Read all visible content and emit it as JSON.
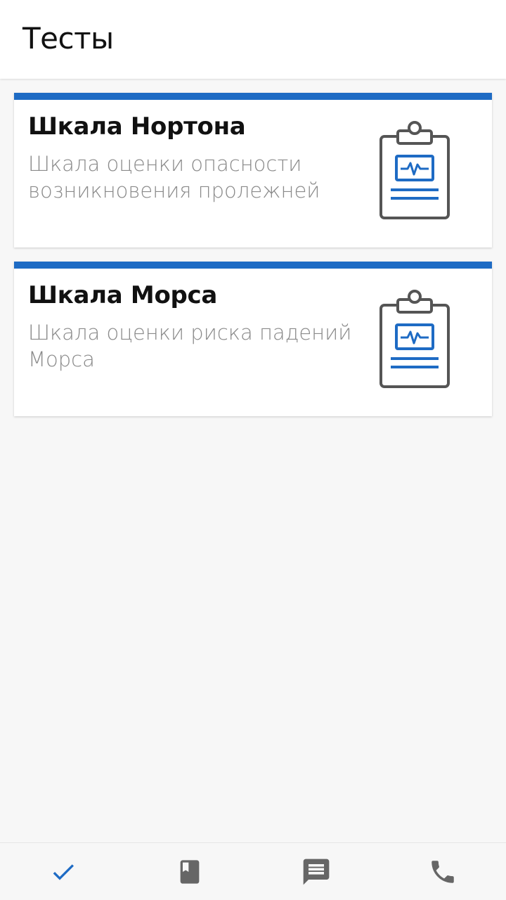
{
  "app_bar": {
    "title": "Тесты"
  },
  "tests": [
    {
      "title": "Шкала Нортона",
      "description": "Шкала оценки опасности возникновения пролежней",
      "icon": "clipboard-heartbeat-icon"
    },
    {
      "title": "Шкала Морса",
      "description": "Шкала оценки риска падений Морса",
      "icon": "clipboard-heartbeat-icon"
    }
  ],
  "bottom_nav": {
    "items": [
      {
        "icon": "check-icon",
        "active": true
      },
      {
        "icon": "bookmark-book-icon",
        "active": false
      },
      {
        "icon": "message-icon",
        "active": false
      },
      {
        "icon": "phone-icon",
        "active": false
      }
    ]
  },
  "colors": {
    "accent": "#1e6bc4",
    "icon_gray": "#555555",
    "background": "#f7f7f7"
  }
}
